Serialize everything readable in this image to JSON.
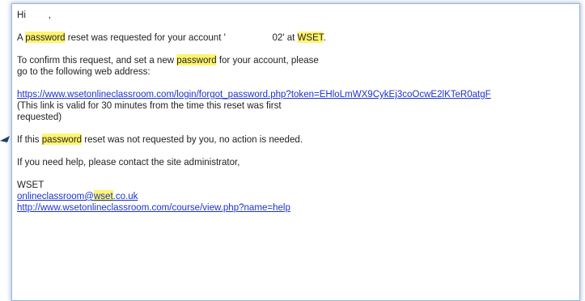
{
  "colors": {
    "highlight": "#fff46e",
    "link": "#1a33cc",
    "border": "#9fb6d3",
    "text": "#222222"
  },
  "email": {
    "greeting": {
      "hi": "Hi",
      "comma": ","
    },
    "request_line": {
      "a": "A",
      "kw": "password",
      "b": "reset was requested for your account '",
      "c": "02' at",
      "org": "WSET",
      "end": "."
    },
    "confirm_line1": {
      "a": "To confirm this request, and set a new",
      "kw": "password",
      "b": "for your account, please"
    },
    "confirm_line2": "go to the following web address:",
    "reset_link": "https://www.wsetonlineclassroom.com/login/forgot_password.php?token=EHloLmWX9CykEj3coOcwE2lKTeR0atgF",
    "validity_line1": "(This link is valid for 30 minutes from the time this reset was first",
    "validity_line2": "requested)",
    "ignore_line": {
      "a": "If this",
      "kw": "password",
      "b": "reset was not requested by you, no action is needed."
    },
    "help_line": "If you need help, please contact the site administrator,",
    "signature": {
      "org": "WSET",
      "email_a": "onlineclassroom@",
      "email_kw": "wset",
      "email_b": ".co.uk",
      "help_url": "http://www.wsetonlineclassroom.com/course/view.php?name=help"
    }
  }
}
